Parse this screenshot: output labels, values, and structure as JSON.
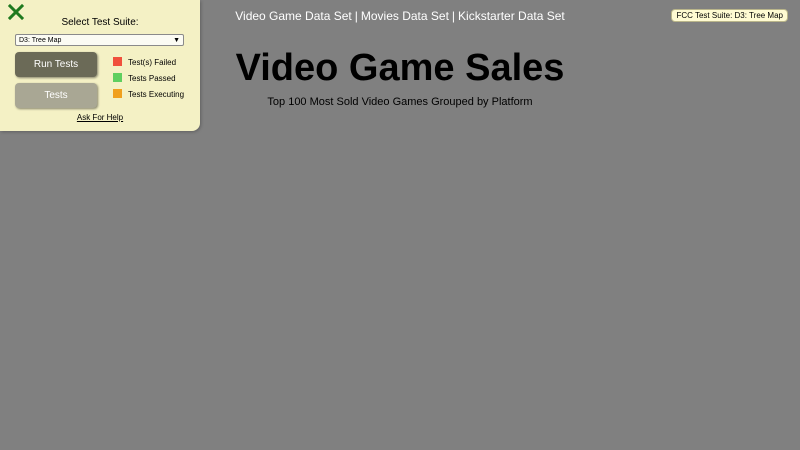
{
  "nav": {
    "links": [
      {
        "label": "Video Game Data Set"
      },
      {
        "label": "Movies Data Set"
      },
      {
        "label": "Kickstarter Data Set"
      }
    ],
    "separator": "|"
  },
  "main": {
    "title": "Video Game Sales",
    "description": "Top 100 Most Sold Video Games Grouped by Platform"
  },
  "fcc_badge": "FCC Test Suite: D3: Tree Map",
  "test_panel": {
    "select_label": "Select Test Suite:",
    "selected_suite": "D3: Tree Map",
    "run_button": "Run Tests",
    "tests_button": "Tests",
    "legend": [
      {
        "label": "Test(s) Failed",
        "color": "#f0503c"
      },
      {
        "label": "Tests Passed",
        "color": "#5fcf5f"
      },
      {
        "label": "Tests Executing",
        "color": "#f0a01e"
      }
    ],
    "help_link": "Ask For Help",
    "close_icon_color": "#1f7a1f"
  },
  "colors": {
    "page_background": "#808080",
    "panel_background": "#f4f1c5"
  }
}
